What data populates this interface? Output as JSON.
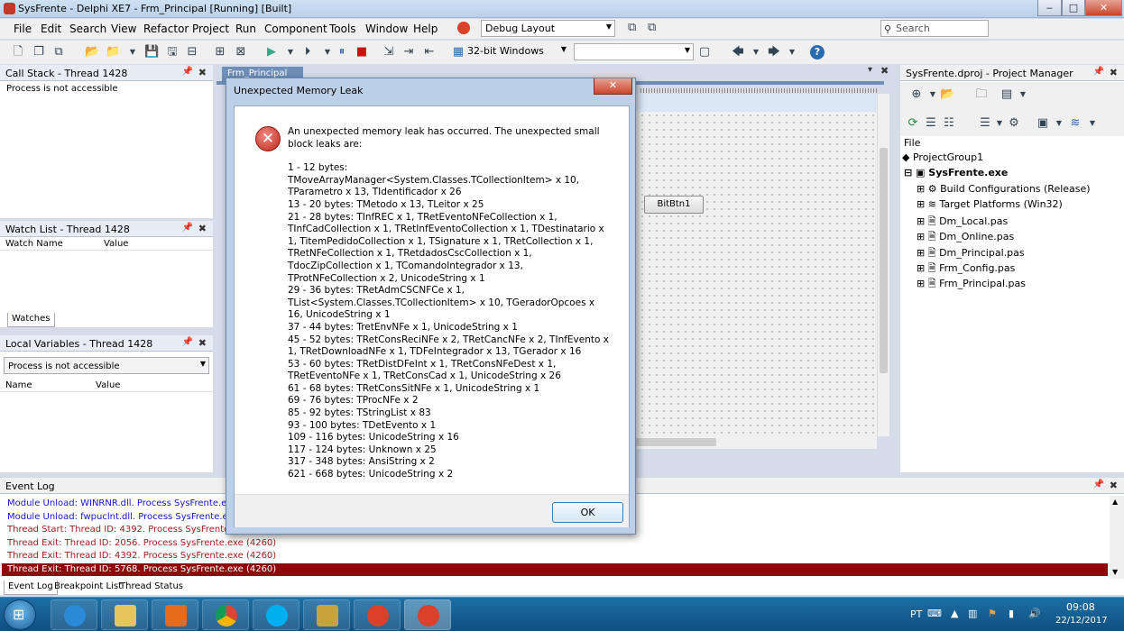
{
  "window": {
    "title": "SysFrente - Delphi XE7 - Frm_Principal [Running] [Built]",
    "min": "‒",
    "max": "□",
    "close": "✕"
  },
  "menu": [
    "File",
    "Edit",
    "Search",
    "View",
    "Refactor",
    "Project",
    "Run",
    "Component",
    "Tools",
    "Window",
    "Help"
  ],
  "layout_combo": "Debug Layout",
  "search_placeholder": "Search",
  "platform_combo": "32-bit Windows",
  "call_stack": {
    "title": "Call Stack - Thread 1428",
    "text": "Process is not accessible"
  },
  "watch_list": {
    "title": "Watch List - Thread 1428",
    "col_name": "Watch Name",
    "col_value": "Value",
    "tab": "Watches"
  },
  "local_vars": {
    "title": "Local Variables - Thread 1428",
    "combo": "Process is not accessible",
    "col_name": "Name",
    "col_value": "Value"
  },
  "designer": {
    "tab": "Frm_Principal",
    "button": "BitBtn1"
  },
  "project_manager": {
    "title": "SysFrente.dproj - Project Manager",
    "file_label": "File",
    "group": "ProjectGroup1",
    "project": "SysFrente.exe",
    "items": [
      "Build Configurations (Release)",
      "Target Platforms (Win32)",
      "Dm_Local.pas",
      "Dm_Online.pas",
      "Dm_Principal.pas",
      "Frm_Config.pas",
      "Frm_Principal.pas"
    ]
  },
  "event_log": {
    "title": "Event Log",
    "lines": [
      {
        "text": "Module Unload: WINRNR.dll. Process SysFrente.exe (4260)",
        "kind": "module"
      },
      {
        "text": "Module Unload: fwpuclnt.dll. Process SysFrente.exe (4260)",
        "kind": "module"
      },
      {
        "text": "Thread Start: Thread ID: 4392. Process SysFrente.exe (4260)",
        "kind": "thread"
      },
      {
        "text": "Thread Exit: Thread ID: 2056. Process SysFrente.exe (4260)",
        "kind": "thread"
      },
      {
        "text": "Thread Exit: Thread ID: 4392. Process SysFrente.exe (4260)",
        "kind": "thread"
      },
      {
        "text": "Thread Exit: Thread ID: 5768. Process SysFrente.exe (4260)",
        "kind": "selected"
      }
    ],
    "tabs": [
      "Event Log",
      "Breakpoint List",
      "Thread Status"
    ]
  },
  "dialog": {
    "title": "Unexpected Memory Leak",
    "close": "✕",
    "intro": "An unexpected memory leak has occurred. The unexpected small block leaks are:",
    "lines": [
      "1 - 12 bytes: TMoveArrayManager<System.Classes.TCollectionItem> x 10, TParametro x 13, TIdentificador x 26",
      "13 - 20 bytes: TMetodo x 13, TLeitor x 25",
      "21 - 28 bytes: TInfREC x 1, TRetEventoNFeCollection x 1, TInfCadCollection x 1, TRetInfEventoCollection x 1, TDestinatario x 1, TitemPedidoCollection x 1, TSignature x 1, TRetCollection x 1, TRetNFeCollection x 1, TRetdadosCscCollection x 1, TdocZipCollection x 1, TComandoIntegrador x 13, TProtNFeCollection x 2, UnicodeString x 1",
      "29 - 36 bytes: TRetAdmCSCNFCe x 1, TList<System.Classes.TCollectionItem> x 10, TGeradorOpcoes x 16, UnicodeString x 1",
      "37 - 44 bytes: TretEnvNFe x 1, UnicodeString x 1",
      "45 - 52 bytes: TRetConsReciNFe x 2, TRetCancNFe x 2, TInfEvento x 1, TRetDownloadNFe x 1, TDFeIntegrador x 13, TGerador x 16",
      "53 - 60 bytes: TRetDistDFeInt x 1, TRetConsNFeDest x 1, TRetEventoNFe x 1, TRetConsCad x 1, UnicodeString x 26",
      "61 - 68 bytes: TRetConsSitNFe x 1, UnicodeString x 1",
      "69 - 76 bytes: TProcNFe x 2",
      "85 - 92 bytes: TStringList x 83",
      "93 - 100 bytes: TDetEvento x 1",
      "109 - 116 bytes: UnicodeString x 16",
      "117 - 124 bytes: Unknown x 25",
      "317 - 348 bytes: AnsiString x 2",
      "621 - 668 bytes: UnicodeString x 2"
    ],
    "ok": "OK"
  },
  "tray": {
    "lang": "PT",
    "time": "09:08",
    "date": "22/12/2017"
  },
  "colors": {
    "selected_row": "#8b0a0a",
    "module_text": "#1515c8",
    "thread_text": "#9c1a1a"
  }
}
